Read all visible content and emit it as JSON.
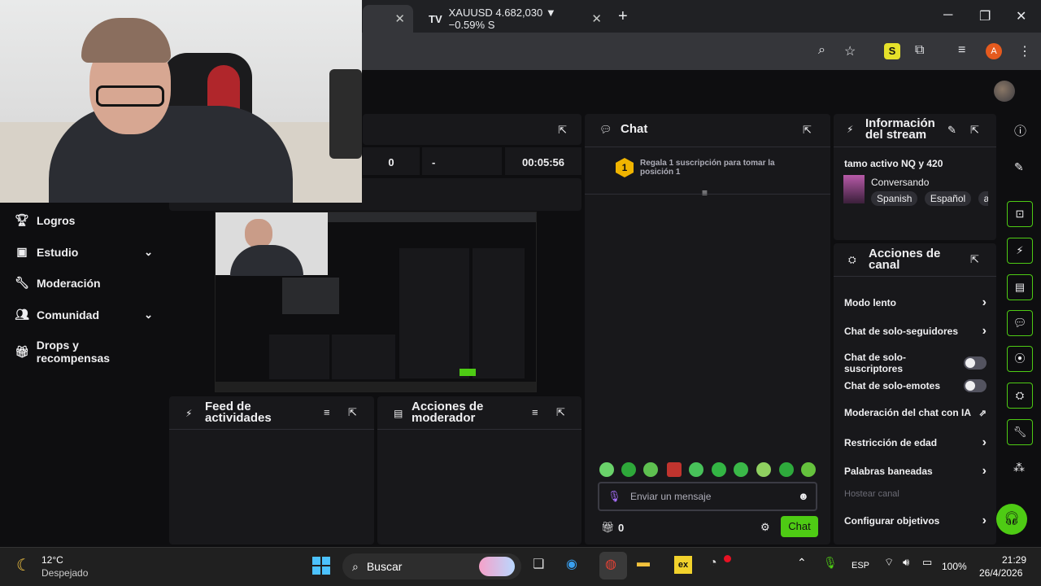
{
  "browser": {
    "tab1_close": "✕",
    "tab2_icon": "TV",
    "tab2_title": "XAUUSD 4.682,030 ▼ −0.59% S",
    "tab2_close": "✕",
    "new_tab": "+",
    "profile_initial": "A"
  },
  "sidebar": {
    "items": [
      {
        "label": "Logros",
        "icon": "trophy-icon"
      },
      {
        "label": "Estudio",
        "icon": "studio-icon",
        "expandable": true
      },
      {
        "label": "Moderación",
        "icon": "wrench-icon"
      },
      {
        "label": "Comunidad",
        "icon": "people-icon",
        "expandable": true
      },
      {
        "label": "Drops y recompensas",
        "icon": "gift-icon"
      }
    ]
  },
  "stats": {
    "value_a": "0",
    "value_b": "-",
    "uptime": "00:05:56"
  },
  "chat": {
    "title": "Chat",
    "sub_gift_rank": "1",
    "sub_gift_text": "Regala 1 suscripción para tomar la posición 1",
    "placeholder": "Enviar un mensaje",
    "points": "0",
    "send_label": "Chat"
  },
  "stream_info": {
    "title_line1": "Información",
    "title_line2": "del stream",
    "stream_title": "tamo activo NQ y 420",
    "category": "Conversando",
    "tags": [
      "Spanish",
      "Español",
      "arg"
    ]
  },
  "channel_actions": {
    "title_line1": "Acciones de",
    "title_line2": "canal",
    "items": [
      {
        "label": "Modo lento",
        "control": "chevron"
      },
      {
        "label": "Chat de solo-seguidores",
        "control": "chevron"
      },
      {
        "label": "Chat de solo-suscriptores",
        "control": "toggle",
        "on": false
      },
      {
        "label": "Chat de solo-emotes",
        "control": "toggle",
        "on": false
      },
      {
        "label": "Moderación del chat con IA",
        "control": "external"
      },
      {
        "label": "Restricción de edad",
        "control": "chevron"
      },
      {
        "label": "Palabras baneadas",
        "control": "chevron"
      },
      {
        "label": "Hostear canal",
        "control": "none",
        "disabled": true
      },
      {
        "label": "Configurar objetivos",
        "control": "chevron"
      }
    ]
  },
  "activity_feed": {
    "title_line1": "Feed de",
    "title_line2": "actividades"
  },
  "mod_actions": {
    "title_line1": "Acciones de",
    "title_line2": "moderador"
  },
  "taskbar": {
    "temp": "12°C",
    "weather": "Despejado",
    "search_placeholder": "Buscar",
    "lang": "ESP",
    "battery": "100%",
    "time": "21:29",
    "date": "26/4/2026"
  },
  "colors": {
    "accent": "#4ecb14",
    "panel": "#18181b",
    "bg": "#0e0e10"
  }
}
